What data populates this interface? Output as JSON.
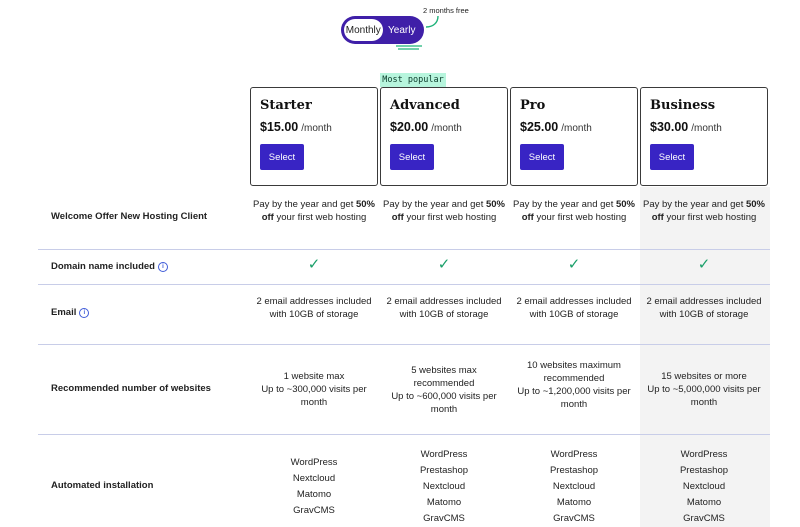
{
  "toggle": {
    "monthly": "Monthly",
    "yearly": "Yearly",
    "free_note": "2 months free"
  },
  "badge": "Most popular",
  "plans": [
    {
      "name": "Starter",
      "price": "$15.00",
      "per": "/month",
      "select": "Select"
    },
    {
      "name": "Advanced",
      "price": "$20.00",
      "per": "/month",
      "select": "Select"
    },
    {
      "name": "Pro",
      "price": "$25.00",
      "per": "/month",
      "select": "Select"
    },
    {
      "name": "Business",
      "price": "$30.00",
      "per": "/month",
      "select": "Select"
    }
  ],
  "rows": {
    "welcome": {
      "label": "Welcome Offer New Hosting Client",
      "pre": "Pay by the year and get ",
      "bold": "50% off",
      "post": " your first web hosting"
    },
    "domain": {
      "label": "Domain name included",
      "value": "✓"
    },
    "email": {
      "label": "Email",
      "value": "2 email addresses included with 10GB of storage"
    },
    "websites": {
      "label": "Recommended number of websites",
      "cells": [
        {
          "a": "1 website max",
          "b": "Up to ~300,000 visits per month"
        },
        {
          "a": "5 websites max recommended",
          "b": "Up to ~600,000 visits per month"
        },
        {
          "a": "10 websites maximum recommended",
          "b": "Up to ~1,200,000 visits per month"
        },
        {
          "a": "15 websites or more",
          "b": "Up to ~5,000,000 visits per month"
        }
      ]
    },
    "install": {
      "label": "Automated installation",
      "cells": [
        [
          "WordPress",
          "Nextcloud",
          "Matomo",
          "GravCMS"
        ],
        [
          "WordPress",
          "Prestashop",
          "Nextcloud",
          "Matomo",
          "GravCMS"
        ],
        [
          "WordPress",
          "Prestashop",
          "Nextcloud",
          "Matomo",
          "GravCMS"
        ],
        [
          "WordPress",
          "Prestashop",
          "Nextcloud",
          "Matomo",
          "GravCMS"
        ]
      ]
    }
  },
  "colors": {
    "accent": "#3824c4",
    "toggle": "#3f1fa8",
    "badge": "#b7f5dd",
    "check": "#1aa06a"
  }
}
